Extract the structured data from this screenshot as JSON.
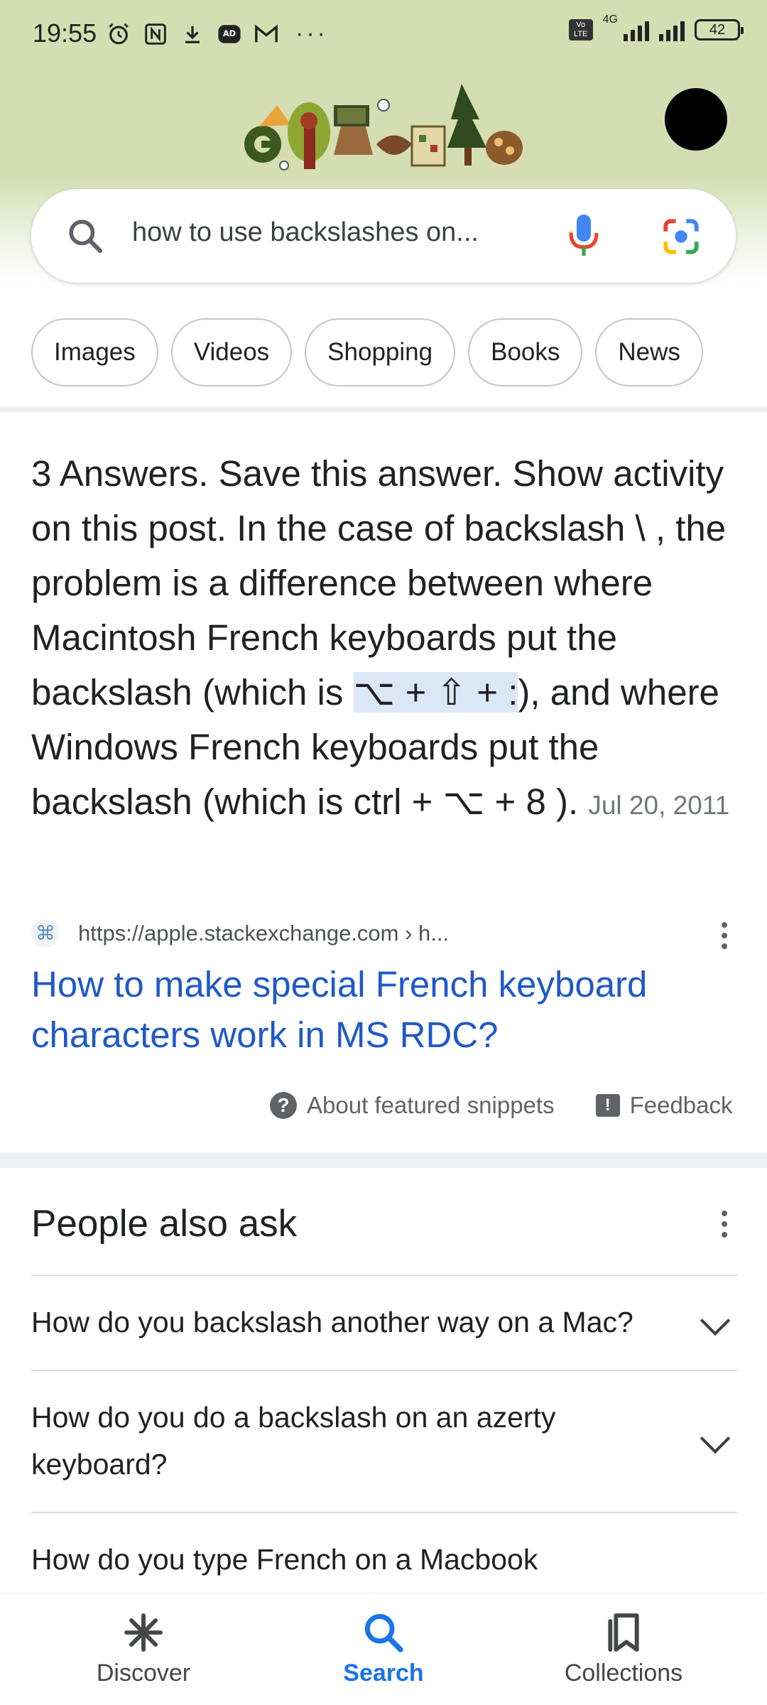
{
  "status_bar": {
    "time": "19:55",
    "network": "4G",
    "volte": "Vo LTE",
    "battery": "42",
    "left_icons": [
      "alarm-icon",
      "nfc-icon",
      "download-icon",
      "adblock-icon",
      "gmail-icon",
      "more-dots-icon"
    ]
  },
  "header": {
    "logo_alt": "Google",
    "avatar": "account-avatar"
  },
  "search": {
    "query": "how to use backslashes on..."
  },
  "chips": [
    "Images",
    "Videos",
    "Shopping",
    "Books",
    "News"
  ],
  "snippet": {
    "text_1": "3 Answers. Save this answer. Show activity on this post. In the case of backslash \\ , the problem is a difference between where Macintosh French keyboards put the backslash (which is ",
    "highlight": "⌥ + ⇧ + :",
    "text_2": "), and where Windows French keyboards put the backslash (which is ctrl + ⌥ + 8 ). ",
    "date": "Jul 20, 2011",
    "source_url": "https://apple.stackexchange.com › h...",
    "favicon": "⌘",
    "title": "How to make special French keyboard characters work in MS RDC?",
    "about_label": "About featured snippets",
    "feedback_label": "Feedback"
  },
  "people_also_ask": {
    "title": "People also ask",
    "questions": [
      "How do you backslash another way on a Mac?",
      "How do you do a backslash on an azerty keyboard?",
      "How do you type French on a Macbook keyboard?"
    ]
  },
  "bottom_nav": {
    "items": [
      {
        "label": "Discover",
        "icon": "asterisk-icon",
        "active": false
      },
      {
        "label": "Search",
        "icon": "search-icon",
        "active": true
      },
      {
        "label": "Collections",
        "icon": "bookmarks-icon",
        "active": false
      }
    ]
  },
  "colors": {
    "header_bg": "#d4deb2",
    "link": "#1f58c9",
    "active_nav": "#1a73e8",
    "highlight": "#dbe7f6"
  }
}
